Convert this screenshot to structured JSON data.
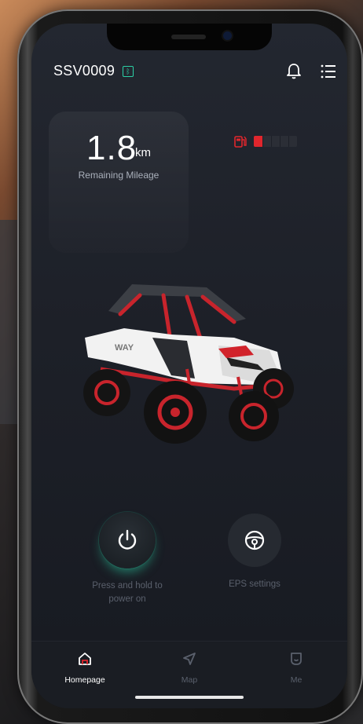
{
  "header": {
    "device_name": "SSV0009",
    "bluetooth_icon": "bluetooth-icon",
    "notification_icon": "bell-icon",
    "menu_icon": "menu-icon"
  },
  "mileage": {
    "value": "1.8",
    "unit": "km",
    "label": "Remaining Mileage"
  },
  "fuel": {
    "icon": "fuel-icon",
    "level_fraction": 0.22,
    "color": "#e0262d"
  },
  "vehicle": {
    "badge_text": "WAY"
  },
  "actions": {
    "power": {
      "icon": "power-icon",
      "label": "Press and hold to power on"
    },
    "eps": {
      "icon": "steering-wheel-icon",
      "label": "EPS settings"
    }
  },
  "tabs": [
    {
      "label": "Homepage",
      "icon": "home-icon",
      "active": true
    },
    {
      "label": "Map",
      "icon": "navigation-icon",
      "active": false
    },
    {
      "label": "Me",
      "icon": "profile-icon",
      "active": false
    }
  ],
  "colors": {
    "accent": "#2bd1a6",
    "background": "#1d2028",
    "alert": "#e0262d"
  }
}
